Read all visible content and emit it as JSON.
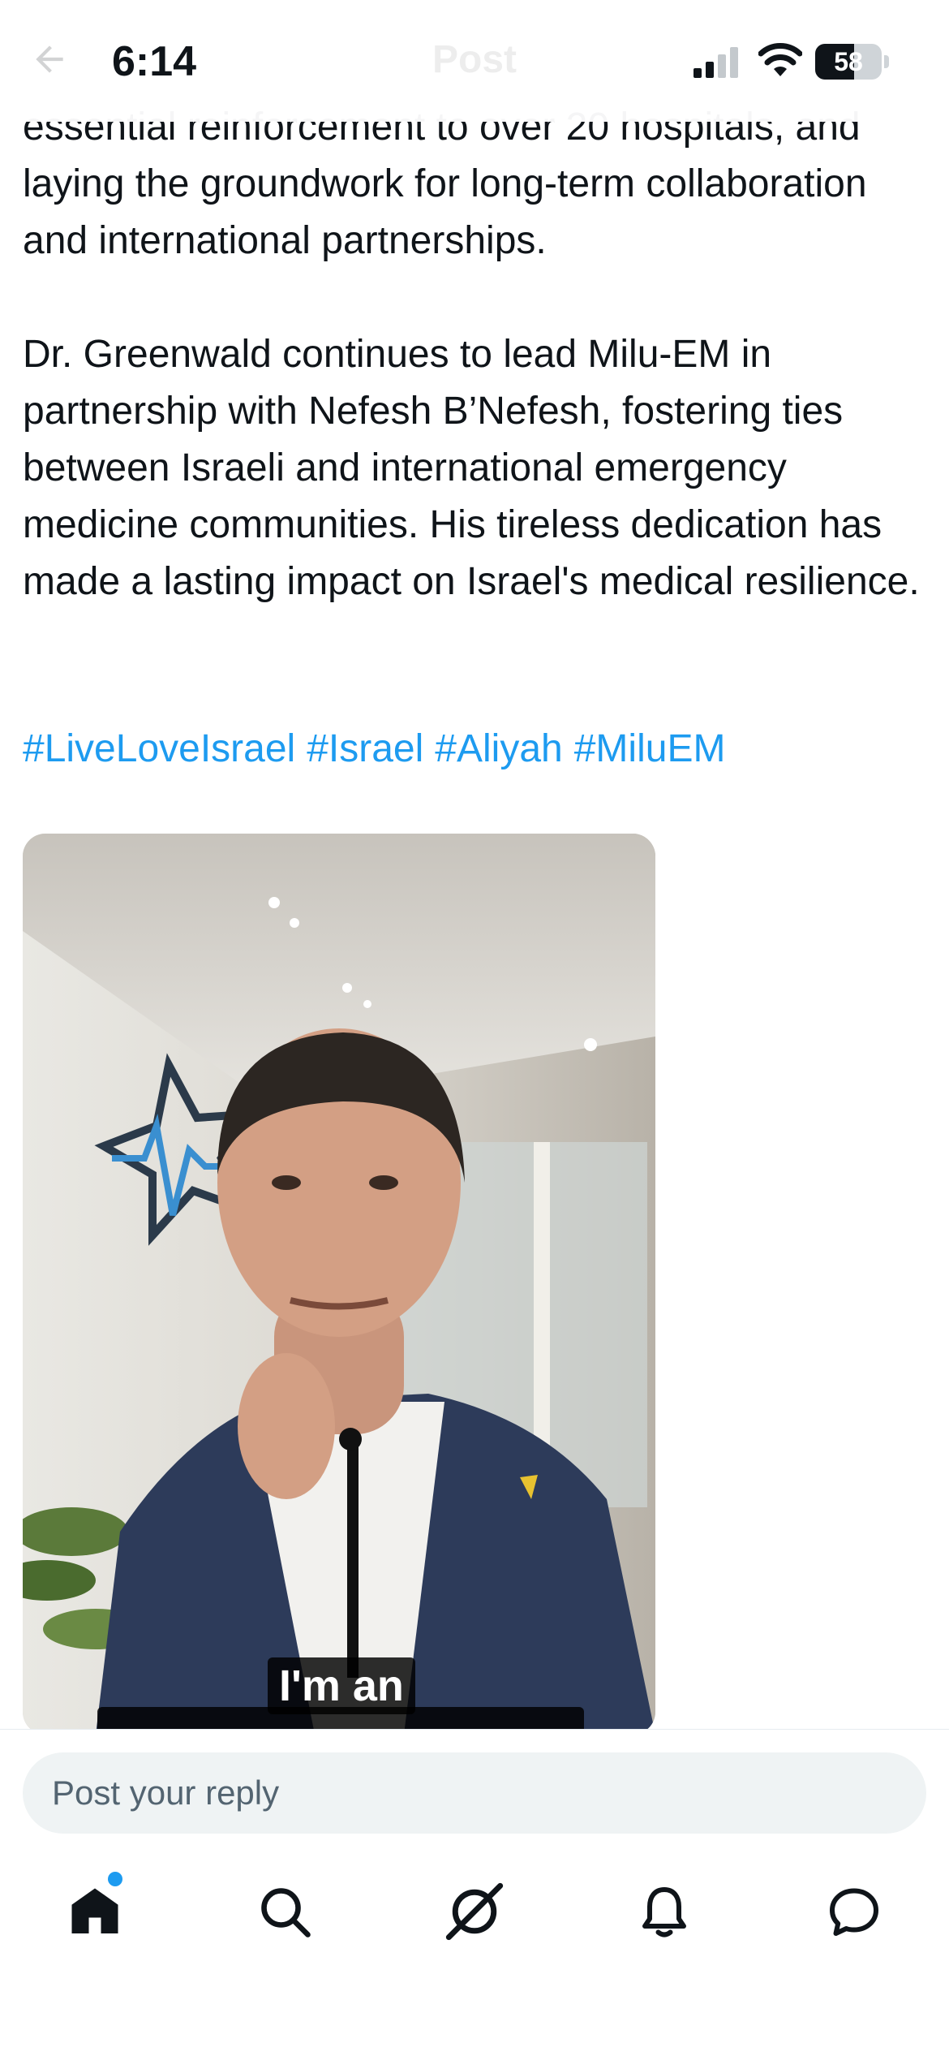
{
  "status_bar": {
    "time": "6:14",
    "battery": "58"
  },
  "header": {
    "title": "Post"
  },
  "post": {
    "paragraphs": [
      "essential reinforcement to over 20 hospitals, and laying the groundwork for long-term collaboration and international partnerships.",
      "Dr. Greenwald continues to lead Milu-EM in partnership with Nefesh B’Nefesh, fostering ties between Israeli and international emergency medicine communities. His tireless dedication has made a lasting impact on Israel's medical resilience."
    ],
    "hashtags": [
      "#LiveLoveIsrael",
      "#Israel",
      "#Aliyah",
      "#MiluEM"
    ],
    "video": {
      "caption_line1": "I'm an"
    }
  },
  "reply": {
    "placeholder": "Post your reply"
  },
  "tabbar": {
    "items": [
      {
        "name": "home",
        "icon": "home-icon",
        "active": true,
        "has_notification": true
      },
      {
        "name": "search",
        "icon": "search-icon"
      },
      {
        "name": "grok",
        "icon": "grok-icon"
      },
      {
        "name": "notifications",
        "icon": "bell-icon"
      },
      {
        "name": "messages",
        "icon": "message-icon"
      }
    ]
  },
  "colors": {
    "link": "#1d9bf0",
    "text": "#0f1419",
    "input_bg": "#eff3f4"
  }
}
